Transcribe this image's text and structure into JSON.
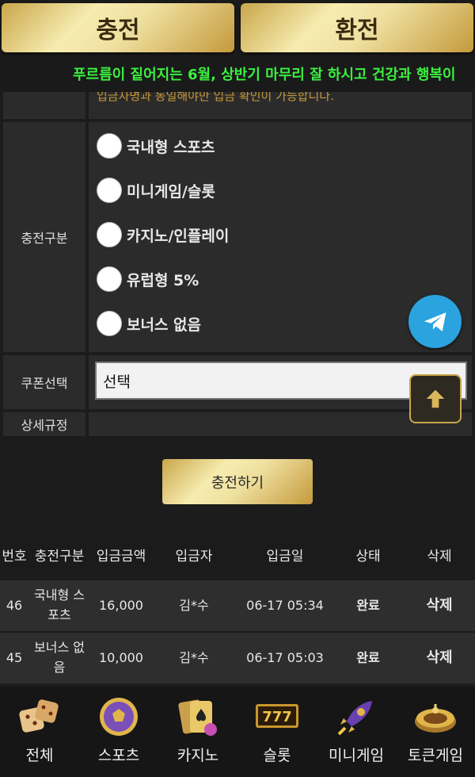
{
  "header": {
    "charge_label": "충전",
    "exchange_label": "환전"
  },
  "marquee": {
    "text": "푸르름이 짙어지는 6월, 상반기 마무리 잘 하시고 건강과 행복이"
  },
  "form": {
    "notice_partial": "입금자명과 동일해야만 입금 확인이 가능합니다.",
    "charge_type": {
      "label": "충전구분",
      "options": [
        "국내형 스포츠",
        "미니게임/슬롯",
        "카지노/인플레이",
        "유럽형 5%",
        "보너스 없음"
      ]
    },
    "coupon": {
      "label": "쿠폰선택",
      "selected": "선택"
    },
    "rules": {
      "label": "상세규정"
    }
  },
  "submit_label": "충전하기",
  "history": {
    "headers": [
      "번호",
      "충전구분",
      "입금금액",
      "입금자",
      "입금일",
      "상태",
      "삭제"
    ],
    "rows": [
      {
        "no": "46",
        "type_l1": "국내형 스",
        "type_l2": "포츠",
        "amount": "16,000",
        "depositor": "김*수",
        "date": "06-17 05:34",
        "status": "완료",
        "delete": "삭제"
      },
      {
        "no": "45",
        "type_l1": "보너스 없",
        "type_l2": "음",
        "amount": "10,000",
        "depositor": "김*수",
        "date": "06-17 05:03",
        "status": "완료",
        "delete": "삭제"
      }
    ]
  },
  "bottom_nav": [
    {
      "label": "전체",
      "icon": "dice-icon"
    },
    {
      "label": "스포츠",
      "icon": "soccer-ball-icon"
    },
    {
      "label": "카지노",
      "icon": "cards-icon"
    },
    {
      "label": "슬롯",
      "icon": "slot-777-icon"
    },
    {
      "label": "미니게임",
      "icon": "rocket-icon"
    },
    {
      "label": "토큰게임",
      "icon": "roulette-icon"
    }
  ],
  "colors": {
    "gold": "#d9bf6a",
    "marquee": "#3cf041",
    "telegram": "#2aa3df"
  }
}
